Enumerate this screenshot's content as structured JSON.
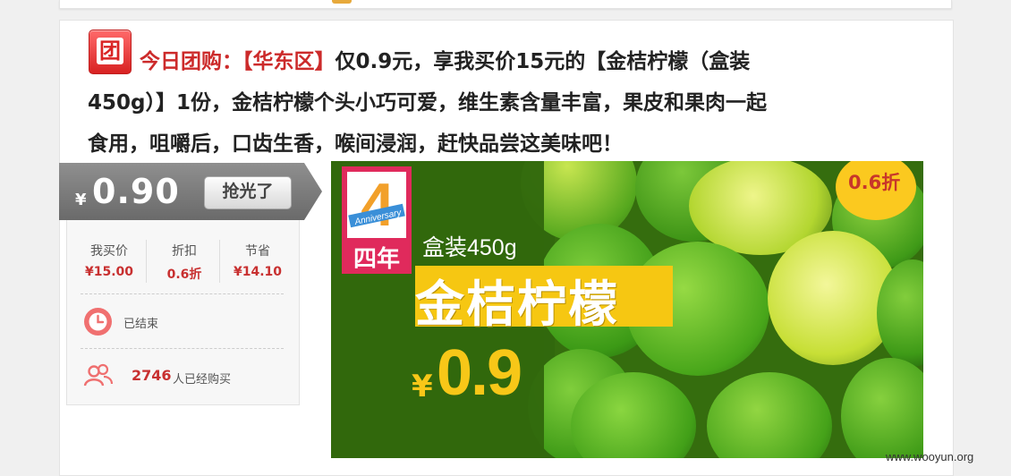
{
  "deal": {
    "tag": "今日团购：",
    "region": "【华东区】",
    "title_lines": [
      "仅0.9元，享我买价15元的【金桔柠檬（盒装",
      "450g）】1份，金桔柠檬个头小巧可爱，维生素含量丰富，果皮和果肉一起",
      "食用，咀嚼后，口齿生香，喉间浸润，赶快品尝这美味吧！"
    ],
    "icon_char": "团"
  },
  "price": {
    "currency": "¥",
    "value": "0.90",
    "button_label": "抢光了"
  },
  "stats": [
    {
      "label": "我买价",
      "value": "¥15.00"
    },
    {
      "label": "折扣",
      "value": "0.6折"
    },
    {
      "label": "节省",
      "value": "¥14.10"
    }
  ],
  "status": {
    "ended_text": "已结束",
    "buyer_count": "2746",
    "buyer_suffix": "人已经购买"
  },
  "banner": {
    "discount_badge": "0.6折",
    "logo_number": "4",
    "logo_word": "Anniversary",
    "logo_text": "四年",
    "box_text": "盒装450g",
    "product_name": "金桔柠檬",
    "currency": "¥",
    "price": "0.9"
  },
  "watermark": "www.wooyun.org",
  "colors": {
    "accent_red": "#cc2a2a",
    "price_gray": "#7a7a7a",
    "banner_green": "#31680d",
    "banner_yellow": "#f6c712"
  }
}
